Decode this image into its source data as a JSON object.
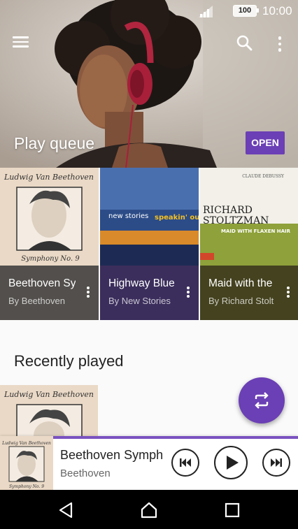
{
  "status": {
    "battery": "100",
    "time": "10:00"
  },
  "hero": {
    "title": "Play queue",
    "open_label": "OPEN"
  },
  "queue": [
    {
      "title": "Beethoven Sy",
      "artist": "By Beethoven",
      "color": "#524f4c"
    },
    {
      "title": "Highway Blue",
      "artist": "By New Stories",
      "color": "#3b2e5c"
    },
    {
      "title": "Maid with the",
      "artist": "By Richard Stolt",
      "color": "#44421f"
    }
  ],
  "album_art_text": {
    "beethoven": {
      "top": "Ludwig Van Beethoven",
      "bottom": "Symphony No. 9"
    },
    "highway": {
      "band": "new stories",
      "album": "speakin' out"
    },
    "debussy": {
      "composer": "CLAUDE DEBUSSY",
      "line1": "RICHARD",
      "line2": "STOLTZMAN",
      "subtitle": "MAID WITH FLAXEN HAIR"
    }
  },
  "recent": {
    "title": "Recently played"
  },
  "now_playing": {
    "title": "Beethoven Symph",
    "artist": "Beethoven",
    "progress": 1.0
  },
  "colors": {
    "accent": "#6b3fb5"
  }
}
